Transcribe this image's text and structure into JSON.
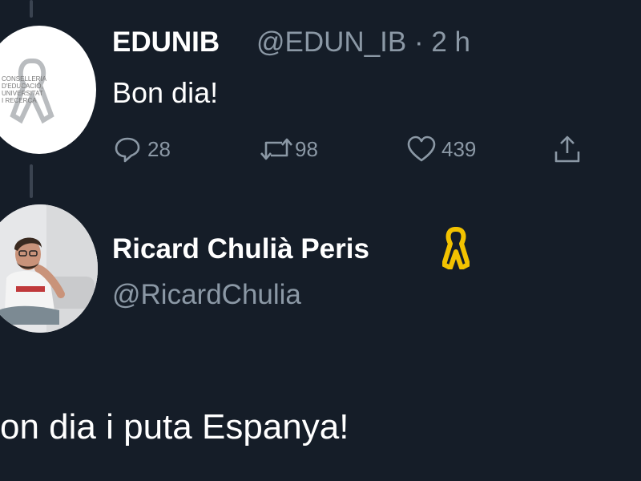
{
  "tweet1": {
    "name": "EDUNIB",
    "handle_time": "@EDUN_IB · 2 h",
    "text": "Bon dia!",
    "avatar_text": [
      "CONSELLERIA",
      "D'EDUCACIÓ, UNIVERSITAT",
      "I RECERCA"
    ],
    "actions": {
      "replies": "28",
      "retweets": "98",
      "likes": "439"
    }
  },
  "tweet2": {
    "name": "Ricard Chulià Peris",
    "handle": "@RicardChulia",
    "text": "on dia i puta Espanya!"
  },
  "icons": {
    "reply": "comment-icon",
    "retweet": "retweet-icon",
    "like": "heart-icon",
    "share": "share-icon",
    "ribbon": "yellow-ribbon-icon"
  },
  "colors": {
    "background": "#151d28",
    "muted": "#8b98a5",
    "ribbon": "#f2c200"
  }
}
